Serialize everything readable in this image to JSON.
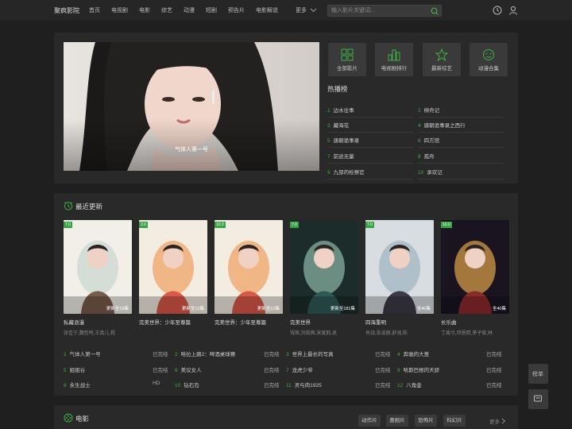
{
  "header": {
    "brand": "聚疯影院",
    "nav": [
      "首页",
      "电视剧",
      "电影",
      "综艺",
      "动漫",
      "短剧",
      "预告片",
      "电影解说"
    ],
    "more": "更多",
    "search_placeholder": "输入影片关键词..."
  },
  "banner": {
    "caption": "气体人第一号"
  },
  "quick": [
    "全部影片",
    "电视剧排行",
    "最新综艺",
    "动漫合集"
  ],
  "hot": {
    "title": "热播榜",
    "items": [
      {
        "n": "1",
        "t": "边水往事"
      },
      {
        "n": "2",
        "t": "柳舟记"
      },
      {
        "n": "3",
        "t": "藏海花"
      },
      {
        "n": "4",
        "t": "唐朝诡事录之西行"
      },
      {
        "n": "5",
        "t": "唐朝诡事录"
      },
      {
        "n": "6",
        "t": "四方馆"
      },
      {
        "n": "7",
        "t": "前途无量"
      },
      {
        "n": "8",
        "t": "孤舟"
      },
      {
        "n": "9",
        "t": "九部的检察官"
      },
      {
        "n": "10",
        "t": "承欢记"
      }
    ]
  },
  "recent": {
    "title": "最近更新",
    "posters": [
      {
        "score": "7.0",
        "title": "私藏浪漫",
        "cast": "张佳宁,魏哲鸣,王真儿,程",
        "ep": "更新至19集"
      },
      {
        "score": "3.0",
        "title": "完美世界：少年至尊篇",
        "cast": "",
        "ep": "更新至12集"
      },
      {
        "score": "10.0",
        "title": "完美世界：少年至尊篇",
        "cast": "",
        "ep": "更新至12集"
      },
      {
        "score": "7.0",
        "title": "完美世界",
        "cast": "钱琛,刘晓茜,宋爱韵,吴",
        "ep": "更新至181集"
      },
      {
        "score": "7.0",
        "title": "四海重明",
        "cast": "肖战,张凌赫,舒润,陈",
        "ep": "全40集"
      },
      {
        "score": "10.0",
        "title": "长乐曲",
        "cast": "丁禹兮,邓恩熙,茅子俊,林",
        "ep": "全40集"
      }
    ],
    "list": [
      {
        "n": "1",
        "t": "气体人第一号",
        "s": "已完结"
      },
      {
        "n": "2",
        "t": "哈拉上路2：啤酒桌球赛",
        "s": "已完结"
      },
      {
        "n": "3",
        "t": "世界上最长的写真",
        "s": "已完结"
      },
      {
        "n": "4",
        "t": "奔驰的大葱",
        "s": "已完结"
      },
      {
        "n": "5",
        "t": "姐姐谷",
        "s": "已完结"
      },
      {
        "n": "6",
        "t": "美议女人",
        "s": "已完结"
      },
      {
        "n": "7",
        "t": "龙虎少爷",
        "s": "已完结"
      },
      {
        "n": "9",
        "t": "哈斯巴根的天骄",
        "s": "已完结"
      },
      {
        "n": "8",
        "t": "永生战士",
        "s": "HD"
      },
      {
        "n": "10",
        "t": "钻石岛",
        "s": "已完结"
      },
      {
        "n": "11",
        "t": "灵与肉1925",
        "s": "已完结"
      },
      {
        "n": "12",
        "t": "八角金",
        "s": "已完结"
      }
    ]
  },
  "movies": {
    "title": "电影",
    "tags": [
      "动作片",
      "喜剧片",
      "恐怖片",
      "科幻片"
    ],
    "more": "更多"
  },
  "side": [
    "榜单",
    "留言"
  ],
  "colors": {
    "accent": "#3cb043",
    "panel": "#292929",
    "bg": "#1f1f1f"
  },
  "icons": [
    "search-icon",
    "history-icon",
    "user-icon",
    "grid-icon",
    "chart-icon",
    "star-icon",
    "smile-icon",
    "clock-icon",
    "film-icon"
  ]
}
